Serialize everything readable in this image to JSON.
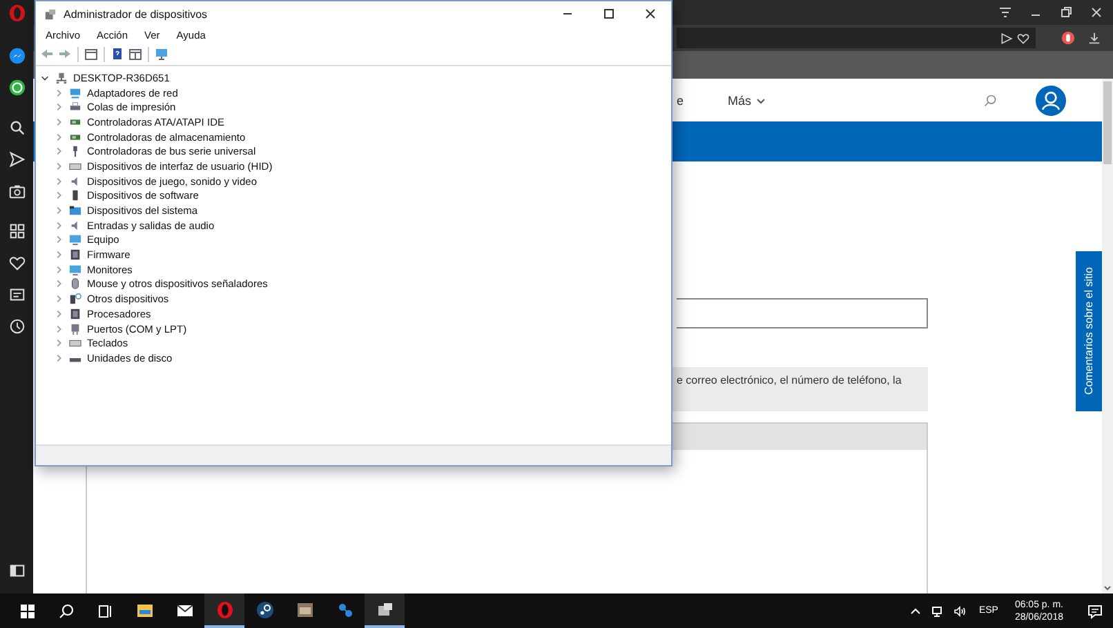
{
  "device_manager": {
    "title": "Administrador de dispositivos",
    "menu": [
      "Archivo",
      "Acción",
      "Ver",
      "Ayuda"
    ],
    "root": {
      "label": "DESKTOP-R36D651",
      "expanded": true,
      "children": [
        {
          "label": "Adaptadores de red",
          "kind": "network",
          "expanded": false
        },
        {
          "label": "Colas de impresión",
          "kind": "printer",
          "expanded": false
        },
        {
          "label": "Controladoras ATA/ATAPI IDE",
          "kind": "board",
          "expanded": false
        },
        {
          "label": "Controladoras de almacenamiento",
          "kind": "board",
          "expanded": false
        },
        {
          "label": "Controladoras de bus serie universal",
          "kind": "usb",
          "expanded": false
        },
        {
          "label": "Dispositivos de interfaz de usuario (HID)",
          "kind": "keyboard",
          "expanded": false
        },
        {
          "label": "Dispositivos de juego, sonido y video",
          "kind": "speaker",
          "expanded": false
        },
        {
          "label": "Dispositivos de software",
          "kind": "phone",
          "expanded": false
        },
        {
          "label": "Dispositivos del sistema",
          "kind": "folder",
          "expanded": false
        },
        {
          "label": "Entradas y salidas de audio",
          "kind": "speaker",
          "expanded": false
        },
        {
          "label": "Equipo",
          "kind": "monitor",
          "expanded": false
        },
        {
          "label": "Firmware",
          "kind": "chip",
          "expanded": false
        },
        {
          "label": "Monitores",
          "kind": "monitor",
          "expanded": false
        },
        {
          "label": "Mouse y otros dispositivos señaladores",
          "kind": "mouse",
          "expanded": false
        },
        {
          "label": "Otros dispositivos",
          "kind": "unknown",
          "expanded": false
        },
        {
          "label": "Procesadores",
          "kind": "chip",
          "expanded": false
        },
        {
          "label": "Puertos (COM y LPT)",
          "kind": "port",
          "expanded": false
        },
        {
          "label": "Teclados",
          "kind": "keyboard",
          "expanded": false
        },
        {
          "label": "Unidades de disco",
          "kind": "disk",
          "expanded": false
        }
      ]
    }
  },
  "browser": {
    "nav_item": "e",
    "more": "Más",
    "notice": "e correo electrónico, el número de teléfono, la",
    "feedback_tab": "Comentarios sobre el sitio"
  },
  "taskbar": {
    "apps": [
      {
        "kind": "explorer",
        "active": false
      },
      {
        "kind": "mail",
        "active": false
      },
      {
        "kind": "opera",
        "active": true
      },
      {
        "kind": "steam",
        "active": false
      },
      {
        "kind": "photo",
        "active": false
      },
      {
        "kind": "network",
        "active": false
      },
      {
        "kind": "devices",
        "active": true
      }
    ],
    "language": "ESP",
    "time": "06:05 p. m.",
    "date": "28/06/2018"
  }
}
